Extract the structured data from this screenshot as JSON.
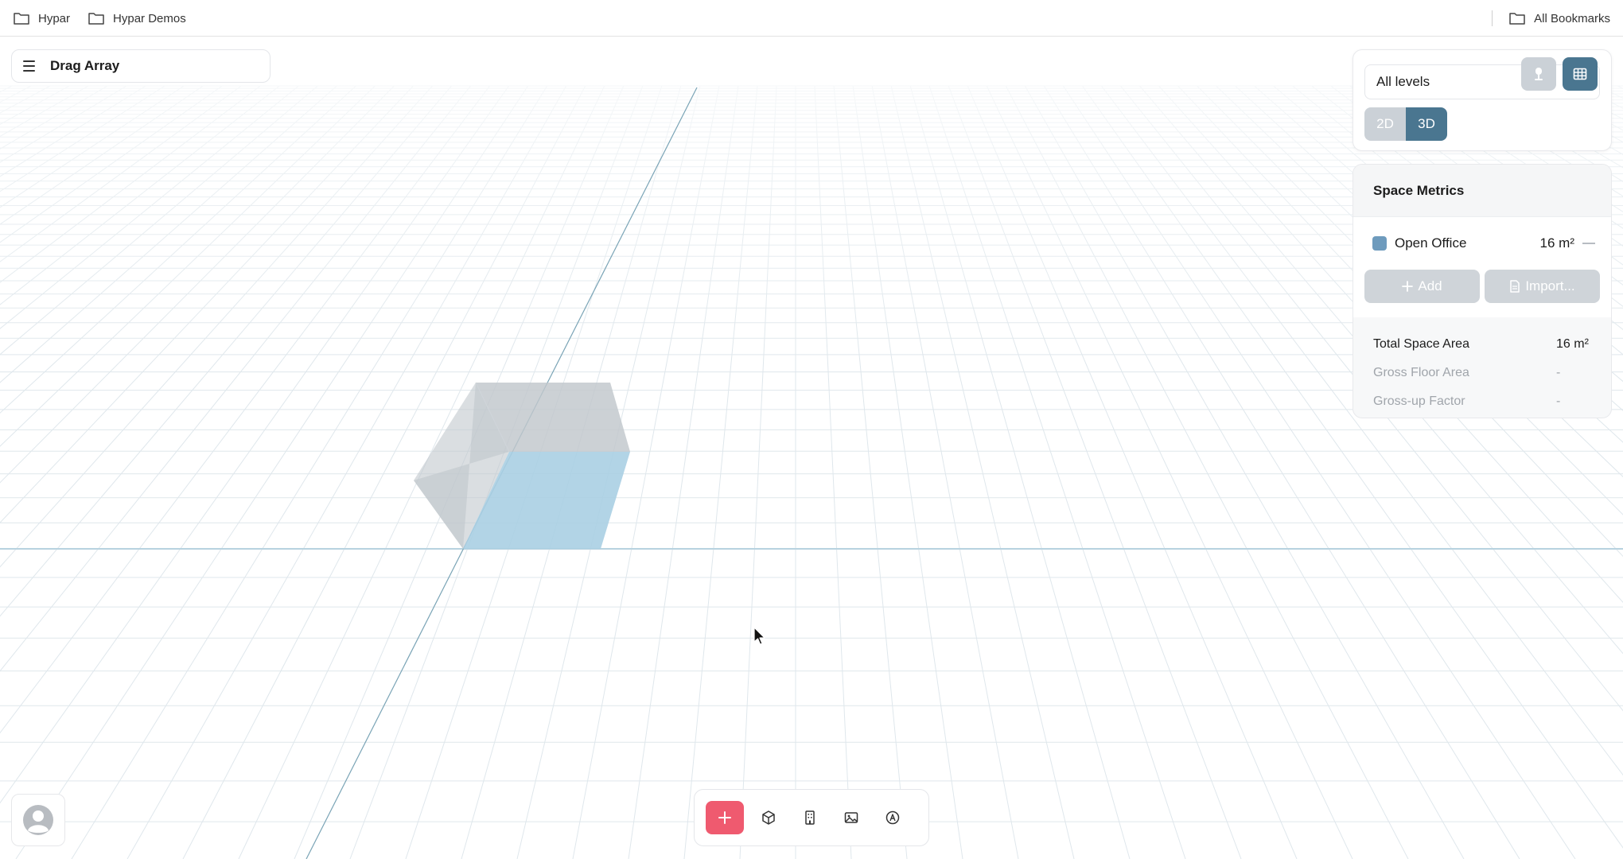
{
  "bookmarks": {
    "items": [
      {
        "label": "Hypar",
        "icon": "folder-icon"
      },
      {
        "label": "Hypar Demos",
        "icon": "folder-icon"
      }
    ],
    "all_bookmarks": "All Bookmarks"
  },
  "project": {
    "title": "Drag Array"
  },
  "view_controls": {
    "level_select": "All levels",
    "mode_2d": "2D",
    "mode_3d": "3D",
    "active_mode": "3D"
  },
  "space_metrics": {
    "title": "Space Metrics",
    "spaces": [
      {
        "name": "Open Office",
        "area": "16 m²",
        "color": "#6e9bbd"
      }
    ],
    "add_label": "Add",
    "import_label": "Import...",
    "summary": [
      {
        "label": "Total Space Area",
        "value": "16 m²"
      },
      {
        "label": "Gross Floor Area",
        "value": "-"
      },
      {
        "label": "Gross-up Factor",
        "value": "-"
      }
    ]
  },
  "toolbar": {
    "icons": [
      "plus-icon",
      "cube-icon",
      "building-icon",
      "image-icon",
      "annotation-icon"
    ]
  },
  "colors": {
    "accent": "#4a7690",
    "add_button": "#ef5a6f",
    "space_fill": "#b4d4e6"
  }
}
